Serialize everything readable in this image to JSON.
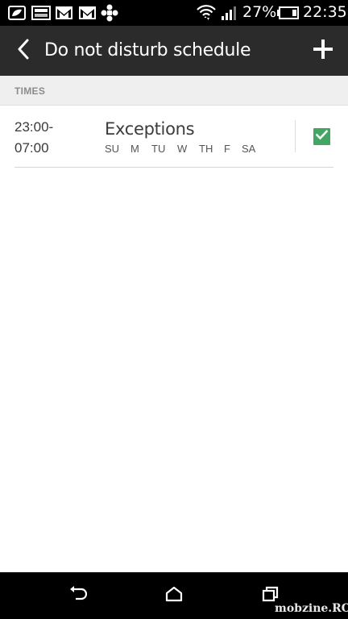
{
  "status_bar": {
    "battery_percent": "27%",
    "time": "22:35",
    "icons": [
      "leaf-icon",
      "image-icon",
      "gmail-icon",
      "gmail-icon",
      "app-icon",
      "wifi-icon",
      "signal-icon",
      "battery-icon"
    ]
  },
  "action_bar": {
    "title": "Do not disturb schedule",
    "back_icon": "chevron-left-icon",
    "add_icon": "plus-icon"
  },
  "section": {
    "label": "TIMES"
  },
  "schedule": {
    "start_time": "23:00-",
    "end_time": "07:00",
    "title": "Exceptions",
    "days": [
      "SU",
      "M",
      "TU",
      "W",
      "TH",
      "F",
      "SA"
    ],
    "checked": true,
    "accent_color": "#42a561"
  },
  "nav_bar": {
    "icons": [
      "back-icon",
      "home-icon",
      "recents-icon"
    ],
    "watermark": "mobzine.RO"
  }
}
